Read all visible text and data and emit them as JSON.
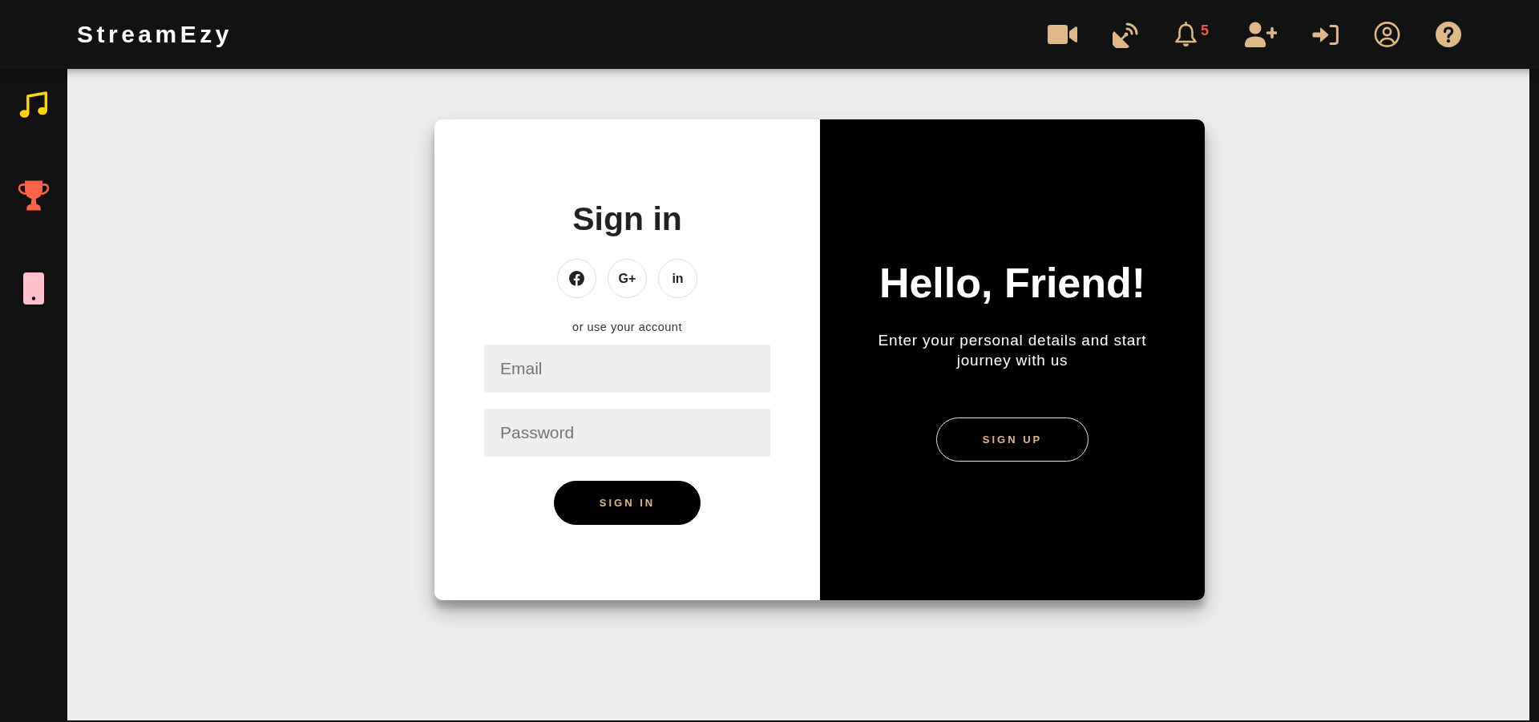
{
  "navbar": {
    "brand": "StreamEzy",
    "notification_badge": "5"
  },
  "sidebar": {
    "items": [
      {
        "color": "#ffd700"
      },
      {
        "color": "#ff6347"
      },
      {
        "color": "#ffc0cb"
      }
    ]
  },
  "sign_in": {
    "title": "Sign in",
    "social_buttons": [
      {
        "kind": "icon"
      },
      {
        "kind": "text",
        "label": "G+"
      },
      {
        "kind": "text",
        "label": "in"
      }
    ],
    "hint": "or use your account",
    "fields": [
      {
        "placeholder": "Email"
      },
      {
        "placeholder": "Password"
      }
    ],
    "button": "SIGN IN"
  },
  "welcome": {
    "title": "Hello, Friend!",
    "text": "Enter your personal details and start journey with us",
    "button": "SIGN UP"
  }
}
